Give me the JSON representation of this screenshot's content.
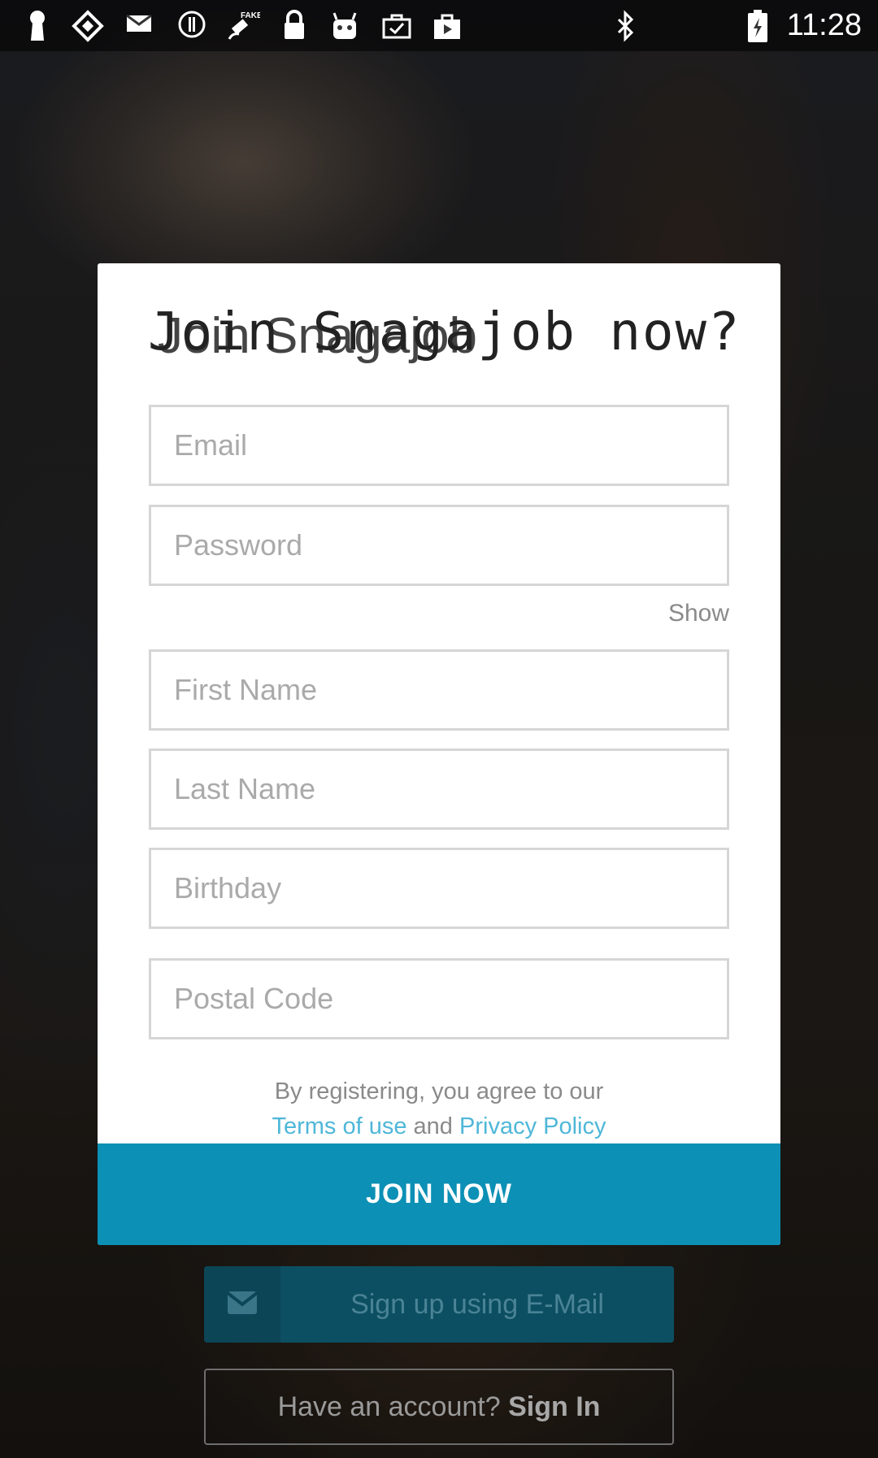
{
  "status_bar": {
    "time": "11:28",
    "icons_left": [
      "keyhole-icon",
      "diamond-app-icon",
      "mail-icon",
      "info-circle-icon",
      "fake-gps-icon",
      "lock-icon",
      "android-icon",
      "briefcase-check-icon",
      "play-store-bag-icon"
    ],
    "icons_right": [
      "bluetooth-icon",
      "battery-icon"
    ],
    "fake_badge": "FAKE"
  },
  "dialog": {
    "title": "Join Snagajob now?",
    "title_ghost": "Join Snagajob",
    "fields": {
      "email": {
        "placeholder": "Email",
        "value": ""
      },
      "password": {
        "placeholder": "Password",
        "value": ""
      },
      "first_name": {
        "placeholder": "First Name",
        "value": ""
      },
      "last_name": {
        "placeholder": "Last Name",
        "value": ""
      },
      "birthday": {
        "placeholder": "Birthday",
        "value": ""
      },
      "postal_code": {
        "placeholder": "Postal Code",
        "value": ""
      }
    },
    "show_password_label": "Show",
    "legal": {
      "line1": "By registering, you agree to our",
      "terms_link": "Terms of use",
      "and": "and",
      "privacy_link": "Privacy Policy"
    },
    "join_button": "JOIN NOW"
  },
  "background": {
    "email_signup_label": "Sign up using E-Mail",
    "email_signup_icon": "envelope-icon",
    "signin_prefix": "Have an account?",
    "signin_link": "Sign In"
  },
  "colors": {
    "accent": "#0c90b5",
    "link": "#4fb7d8",
    "field_border": "#d6d6d6"
  }
}
